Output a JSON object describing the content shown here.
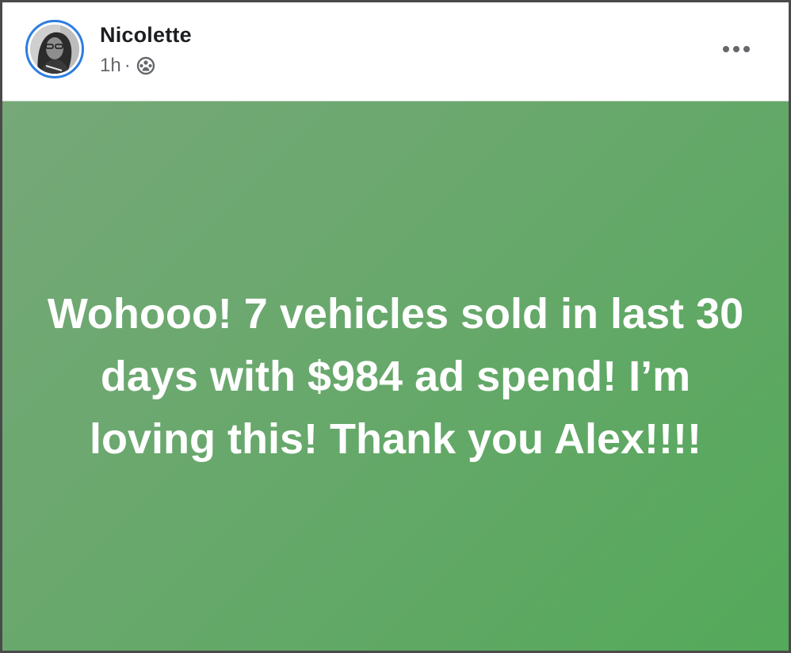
{
  "post": {
    "author": "Nicolette",
    "time": "1h",
    "separator": "·",
    "audience_icon": "friends-icon",
    "more_icon": "more-options-icon",
    "status_text": "Wohooo! 7 vehicles sold in last 30 days with $984 ad spend! I’m loving this! Thank you Alex!!!!",
    "background_color_start": "#76a878",
    "background_color_end": "#54a95a",
    "avatar_ring_color": "#2d7de0"
  }
}
